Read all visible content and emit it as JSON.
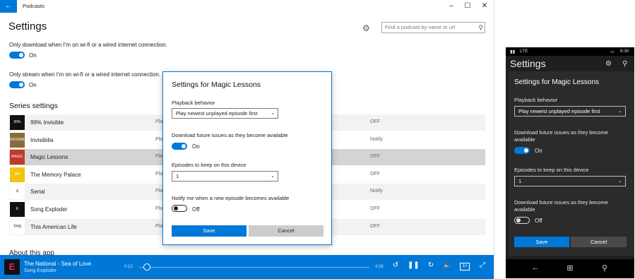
{
  "desktop": {
    "window_title": "Podcasts",
    "page_title": "Settings",
    "search_placeholder": "Find a podcast by name or url",
    "settings": [
      {
        "label": "Only download when I'm on wi-fi or a wired internet connection.",
        "toggle": "On"
      },
      {
        "label": "Only stream when I'm on wi-fi or a wired internet connection.",
        "toggle": "On"
      }
    ],
    "series_title": "Series settings",
    "series": [
      {
        "name": "99% Invisible",
        "playback": "Pla",
        "notify": "OFF",
        "thumb_color": "#111111",
        "thumb_text": "99%"
      },
      {
        "name": "Invisibilia",
        "playback": "Pla",
        "notify": "Notify",
        "thumb_color": "#8a6b3a",
        "thumb_text": "INVISIBILIA"
      },
      {
        "name": "Magic Lessons",
        "playback": "Pla",
        "notify": "OFF",
        "thumb_color": "#c0392b",
        "thumb_text": "MAGIC"
      },
      {
        "name": "The Memory Palace",
        "playback": "Pla",
        "notify": "OFF",
        "thumb_color": "#f1c40f",
        "thumb_text": "MP"
      },
      {
        "name": "Serial",
        "playback": "Pla",
        "notify": "Notify",
        "thumb_color": "#ffffff",
        "thumb_text": "S"
      },
      {
        "name": "Song Exploder",
        "playback": "Pla",
        "notify": "OFF",
        "thumb_color": "#111111",
        "thumb_text": "E"
      },
      {
        "name": "This American Life",
        "playback": "Pla",
        "notify": "OFF",
        "thumb_color": "#ffffff",
        "thumb_text": "THIS"
      }
    ],
    "about_title": "About this app",
    "player": {
      "title": "The National - Sea of Love",
      "show": "Song Exploder",
      "elapsed": "0:12",
      "total": "4:26",
      "progress": 0.05,
      "rate": "1×",
      "skip_back": "10",
      "skip_fwd": "30"
    },
    "dialog": {
      "title": "Settings for Magic Lessons",
      "playback_label": "Playback behavior",
      "playback_value": "Play newest unplayed episode first",
      "download_label": "Download future issues as they become available",
      "download_state": "On",
      "episodes_label": "Episodes to keep on this device",
      "episodes_value": "1",
      "notify_label": "Notify me when a new episode becomes available",
      "notify_state": "Off",
      "save": "Save",
      "cancel": "Cancel"
    }
  },
  "phone": {
    "network": "LTE",
    "time": "6:30",
    "page_title": "Settings",
    "dialog": {
      "title": "Settings for Magic Lessons",
      "playback_label": "Playback behavior",
      "playback_value": "Play newest unplayed episode first",
      "download_label": "Download future issues as they become available",
      "download_state": "On",
      "episodes_label": "Episodes to keep on this device",
      "episodes_value": "1",
      "download2_label": "Download future issues as they become available",
      "download2_state": "Off",
      "save": "Save",
      "cancel": "Cancel"
    }
  },
  "colors": {
    "accent": "#0078d7",
    "phone_bg": "#1f1f1f"
  }
}
